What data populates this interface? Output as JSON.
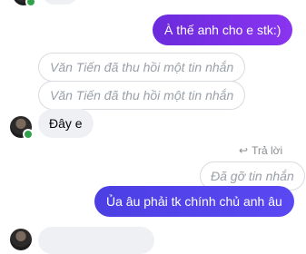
{
  "messages": {
    "out_1": "À thế anh cho e stk:)",
    "recalled_1": "Văn Tiến đã thu hồi một tin nhắn",
    "recalled_2": "Văn Tiến đã thu hồi một tin nhắn",
    "in_1": "Đây e",
    "reply_hint": "Trả lời",
    "removed_1": "Đã gỡ tin nhắn",
    "out_2": "Ủa âu phải tk chính chủ anh âu"
  },
  "icons": {
    "reply": "reply-arrow-icon",
    "online": "online-status-dot"
  },
  "colors": {
    "purple": "#7b2ff0",
    "blue": "#4f46ea",
    "online": "#31a24c"
  }
}
